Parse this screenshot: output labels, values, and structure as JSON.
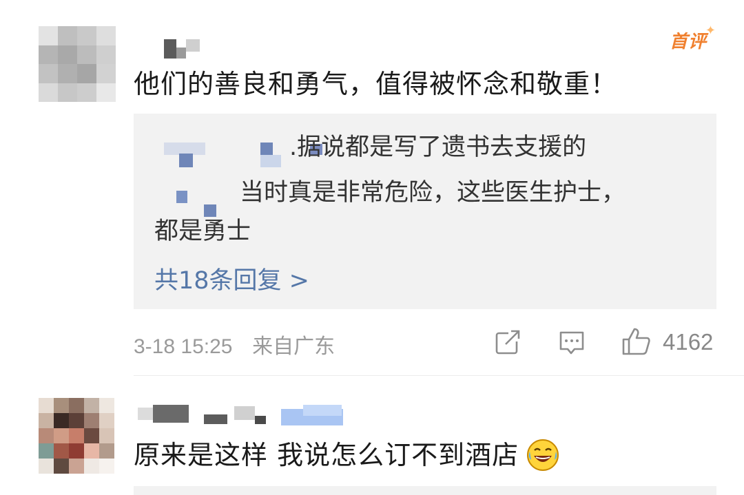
{
  "comments": [
    {
      "badge": "首评",
      "text": "他们的善良和勇气，值得被怀念和敬重！",
      "reply_preview": {
        "line1": ".据说都是写了遗书去支援的",
        "line2": "当时真是非常危险，这些医生护士，",
        "line3": "都是勇士",
        "more": "共18条回复 >"
      },
      "timestamp": "3-18 15:25",
      "source": "来自广东",
      "likes": "4162"
    },
    {
      "text": "原来是这样 我说怎么订不到酒店",
      "emoji": "laughing-crying-emoji"
    }
  ],
  "icons": {
    "share": "share-icon",
    "comment": "comment-icon",
    "like": "thumbs-up-icon"
  },
  "colors": {
    "badge": "#f0802f",
    "link": "#5577a8",
    "meta": "#9a9a9a",
    "reply_bg": "#f2f2f2"
  }
}
